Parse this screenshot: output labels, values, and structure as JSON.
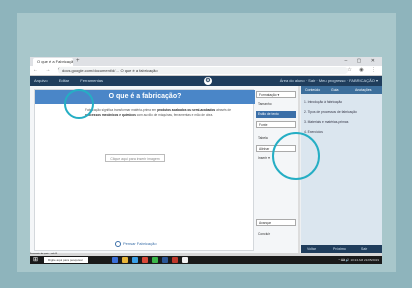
{
  "browser": {
    "tab_title": "O que é a Fabricação - M",
    "new_tab": "+",
    "window_controls": "– ▢ ✕",
    "nav": "← → ⟳",
    "url": "docs.google.com/document/d/… O que é a fabricação",
    "addr_icons": "☆ ◉ ⋮"
  },
  "app": {
    "menu": [
      "Arquivo",
      "Editar",
      "Ferramentas"
    ],
    "logo": "⚙",
    "user": "Área do aluno · Sair · Meu progresso · FABRICAÇÃO ▾"
  },
  "document": {
    "title": "O que é a fabricação?",
    "para_1": "Fabricação significa transformar matéria-prima em ",
    "para_bold_1": "produtos acabados ou semi-acabados",
    "para_2": " através de ",
    "para_bold_2": "processos mecânicos e químicos",
    "para_3": " com auxílio de máquinas, ferramentas e mão de obra.",
    "placeholder": "Clique aqui para inserir imagem",
    "footer": "Pensar Fabricação"
  },
  "tools": [
    "Formatação ▾",
    "Tamanho",
    "Estilo de texto",
    "Fonte",
    "Tabela",
    "Alinhar",
    "Inserir ▾",
    "Avançar",
    "Concluir"
  ],
  "side": {
    "tabs": [
      "Conteúdo",
      "Guia",
      "Anotações"
    ],
    "items": [
      "1. Introdução à fabricação",
      "2. Tipos de processos de fabricação",
      "3. Materiais e matérias-primas",
      "4. Exercícios"
    ],
    "bottom": [
      "Voltar",
      "Próximo",
      "Sair"
    ]
  },
  "status": "Ferramenta de apoio – aula 01",
  "taskbar": {
    "start": "⊞",
    "search": "Digite aqui para pesquisar",
    "clock": "^ ⌨ 🔊 10:24 AM  21/05/2019"
  },
  "colors": {
    "frame_outer": "#8eb4bc",
    "frame_inner": "#a8c7cb",
    "app_header": "#1f3d5c",
    "doc_title_bg": "#4a86c8",
    "highlight_ring": "#25aec4",
    "taskbar": "#1a1a1a"
  }
}
